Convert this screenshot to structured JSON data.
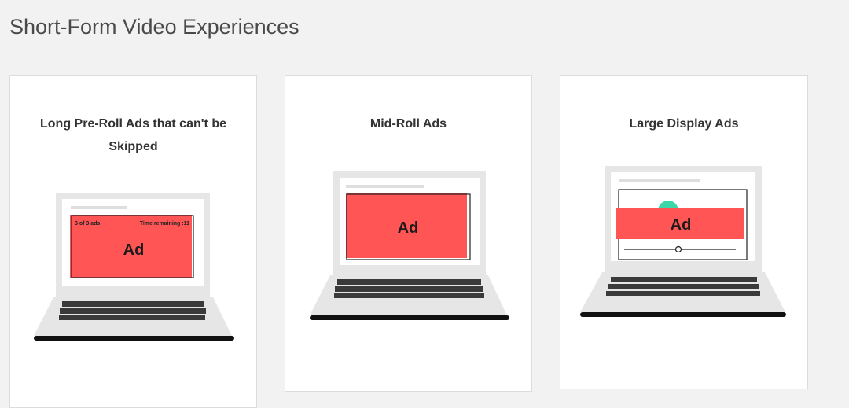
{
  "page": {
    "title": "Short-Form Video Experiences"
  },
  "colors": {
    "background": "#f2f2f2",
    "card": "#ffffff",
    "ad_red": "#ff5555",
    "accent_green": "#3cd6a8",
    "laptop_gray": "#e6e6e6",
    "keyboard_dark": "#3a3a3a"
  },
  "cards": [
    {
      "title": "Long Pre-Roll Ads that can't be Skipped",
      "ad_label": "Ad",
      "ad_counter": "3 of 3 ads",
      "ad_time": "Time remaining :11",
      "icon": "laptop-icon"
    },
    {
      "title": "Mid-Roll Ads",
      "ad_label": "Ad",
      "icon": "laptop-icon"
    },
    {
      "title": "Large Display Ads",
      "ad_label": "Ad",
      "icon": "laptop-icon"
    }
  ]
}
